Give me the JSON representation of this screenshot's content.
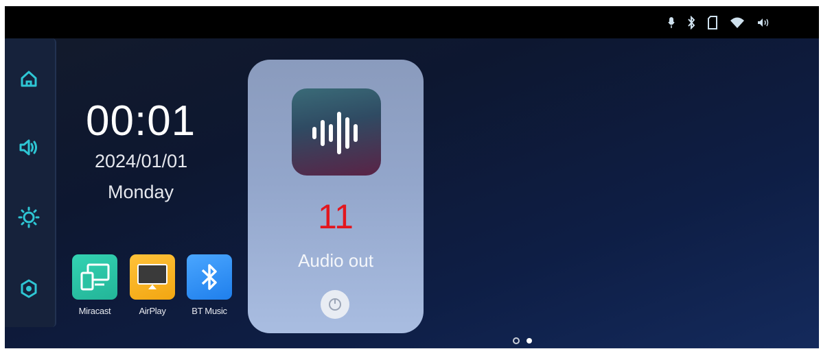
{
  "status_bar": {
    "icons": [
      "mic-icon",
      "bluetooth-icon",
      "sd-card-icon",
      "wifi-icon",
      "volume-icon"
    ]
  },
  "sidebar": {
    "items": [
      {
        "name": "home-icon"
      },
      {
        "name": "volume-icon"
      },
      {
        "name": "brightness-icon"
      },
      {
        "name": "settings-icon"
      }
    ]
  },
  "clock": {
    "time": "00:01",
    "date": "2024/01/01",
    "day": "Monday"
  },
  "apps": [
    {
      "label": "Miracast",
      "icon": "miracast-icon",
      "color": "#2ec6a6"
    },
    {
      "label": "AirPlay",
      "icon": "airplay-icon",
      "color": "#f7b21c"
    },
    {
      "label": "BT Music",
      "icon": "bluetooth-icon",
      "color": "#2f8ef5"
    }
  ],
  "audio_card": {
    "icon": "audio-waveform-icon",
    "value": "11",
    "label": "Audio out",
    "value_color": "#e3161e"
  },
  "pager": {
    "pages": 2,
    "current": 2
  }
}
